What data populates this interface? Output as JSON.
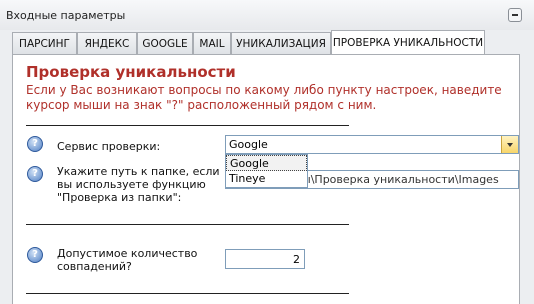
{
  "panel": {
    "title": "Входные параметры"
  },
  "tabs": [
    {
      "label": "ПАРСИНГ"
    },
    {
      "label": "ЯНДЕКС"
    },
    {
      "label": "GOOGLE"
    },
    {
      "label": "MAIL"
    },
    {
      "label": "УНИКАЛИЗАЦИЯ"
    },
    {
      "label": "ПРОВЕРКА УНИКАЛЬНОСТИ"
    }
  ],
  "content": {
    "heading": "Проверка уникальности",
    "hint": "Если у Вас возникают вопросы по какому либо пункту настроек, наведите курсор мыши на знак \"?\" расположенный рядом с ним."
  },
  "service": {
    "label": "Сервис проверки:",
    "value": "Google",
    "options": [
      "Google",
      "Tineye"
    ]
  },
  "folder": {
    "label_line1": "Укажите путь к папке, если",
    "label_line2": "вы используете функцию",
    "label_line3": "\"Проверка из папки\":",
    "value": "D:\\Документы\\Проверка уникальности\\Images"
  },
  "matches": {
    "label_line1": "Допустимое количество",
    "label_line2": "совпадений?",
    "value": "2"
  },
  "icons": {
    "help": "?"
  }
}
